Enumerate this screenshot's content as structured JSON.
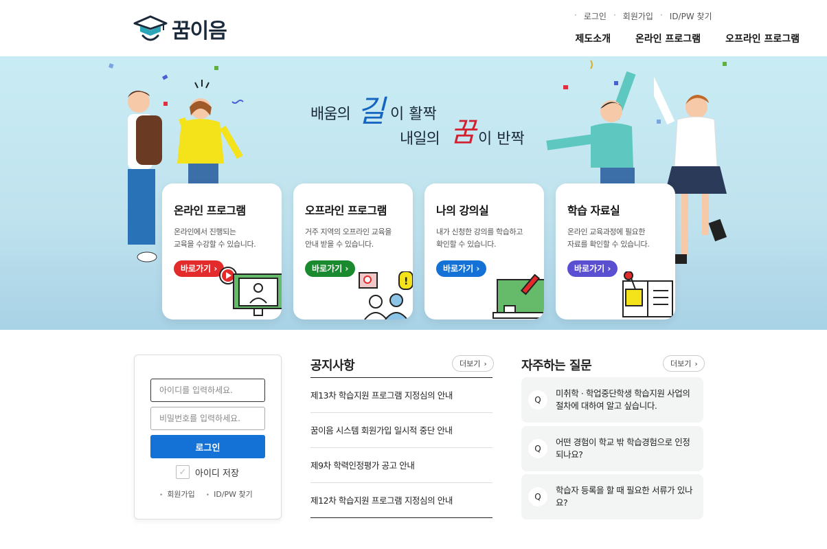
{
  "header": {
    "logo_text": "꿈이음",
    "util_links": [
      "로그인",
      "회원가입",
      "ID/PW 찾기"
    ],
    "nav": [
      "제도소개",
      "온라인 프로그램",
      "오프라인 프로그램"
    ]
  },
  "hero": {
    "slogan_line1_pre": "배움의",
    "slogan_line1_big": "길",
    "slogan_line1_post": "이 활짝",
    "slogan_line2_pre": "내일의",
    "slogan_line2_big": "꿈",
    "slogan_line2_post": "이 반짝",
    "cards": [
      {
        "title": "온라인 프로그램",
        "desc1": "온라인에서 진행되는",
        "desc2": "교육을 수강할 수 있습니다.",
        "button": "바로가기",
        "color": "#e32b2b"
      },
      {
        "title": "오프라인 프로그램",
        "desc1": "거주 지역의 오프라인 교육을",
        "desc2": "안내 받을 수 있습니다.",
        "button": "바로가기",
        "color": "#1a8a2e"
      },
      {
        "title": "나의 강의실",
        "desc1": "내가 신청한 강의를 학습하고",
        "desc2": "확인할 수 있습니다.",
        "button": "바로가기",
        "color": "#1472d6"
      },
      {
        "title": "학습 자료실",
        "desc1": "온라인 교육과정에 필요한",
        "desc2": "자료를 확인할 수 있습니다.",
        "button": "바로가기",
        "color": "#5a4fd0"
      }
    ]
  },
  "login": {
    "id_placeholder": "아이디를 입력하세요.",
    "pw_placeholder": "비밀번호를 입력하세요.",
    "button": "로그인",
    "save_id": "아이디 저장",
    "links": [
      "회원가입",
      "ID/PW 찾기"
    ]
  },
  "notice": {
    "title": "공지사항",
    "more": "더보기",
    "items": [
      "제13차 학습지원 프로그램 지정심의 안내",
      "꿈이음 시스템 회원가입 일시적 중단 안내",
      "제9차 학력인정평가 공고 안내",
      "제12차 학습지원 프로그램 지정심의 안내"
    ]
  },
  "faq": {
    "title": "자주하는 질문",
    "more": "더보기",
    "q_mark": "Q",
    "items": [
      "미취학 · 학업중단학생 학습지원 사업의 절차에 대하여 알고 싶습니다.",
      "어떤 경험이 학교 밖 학습경험으로 인정 되나요?",
      "학습자 등록을 할 때 필요한 서류가 있나요?"
    ]
  }
}
